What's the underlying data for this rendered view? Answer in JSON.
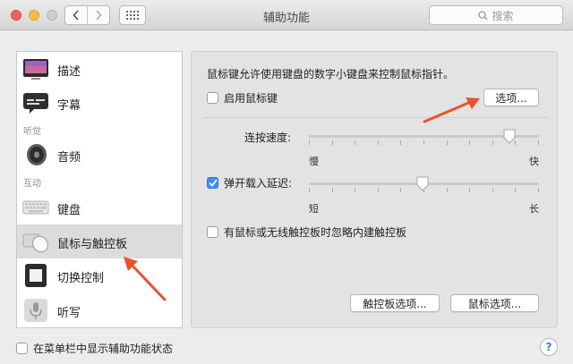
{
  "window": {
    "title": "辅助功能"
  },
  "search": {
    "placeholder": "搜索"
  },
  "sidebar": {
    "items": [
      {
        "label": "描述",
        "icon": "description-icon"
      },
      {
        "label": "字幕",
        "icon": "captions-icon"
      },
      {
        "label": "音频",
        "icon": "speaker-icon"
      },
      {
        "label": "键盘",
        "icon": "keyboard-icon"
      },
      {
        "label": "鼠标与触控板",
        "icon": "mouse-icon",
        "selected": true
      },
      {
        "label": "切换控制",
        "icon": "switch-control-icon"
      },
      {
        "label": "听写",
        "icon": "microphone-icon"
      }
    ],
    "sections": {
      "hearing": "听觉",
      "interaction": "互动"
    }
  },
  "panel": {
    "description": "鼠标键允许使用键盘的数字小键盘来控制鼠标指针。",
    "enable_mouse_keys": {
      "label": "启用鼠标键",
      "checked": false
    },
    "options_button": "选项...",
    "double_click_speed": {
      "label": "连按速度:",
      "min_label": "慢",
      "max_label": "快",
      "value": 0.9
    },
    "spring_loading": {
      "label": "弹开载入延迟:",
      "checked": true,
      "min_label": "短",
      "max_label": "长",
      "value": 0.5
    },
    "ignore_trackpad": {
      "label": "有鼠标或无线触控板时忽略内建触控板",
      "checked": false
    },
    "trackpad_options_button": "触控板选项...",
    "mouse_options_button": "鼠标选项..."
  },
  "footer": {
    "show_in_menubar": {
      "label": "在菜单栏中显示辅助功能状态",
      "checked": false
    },
    "help": "?"
  },
  "colors": {
    "accent": "#3b8ef7",
    "arrow": "#e8532c"
  }
}
